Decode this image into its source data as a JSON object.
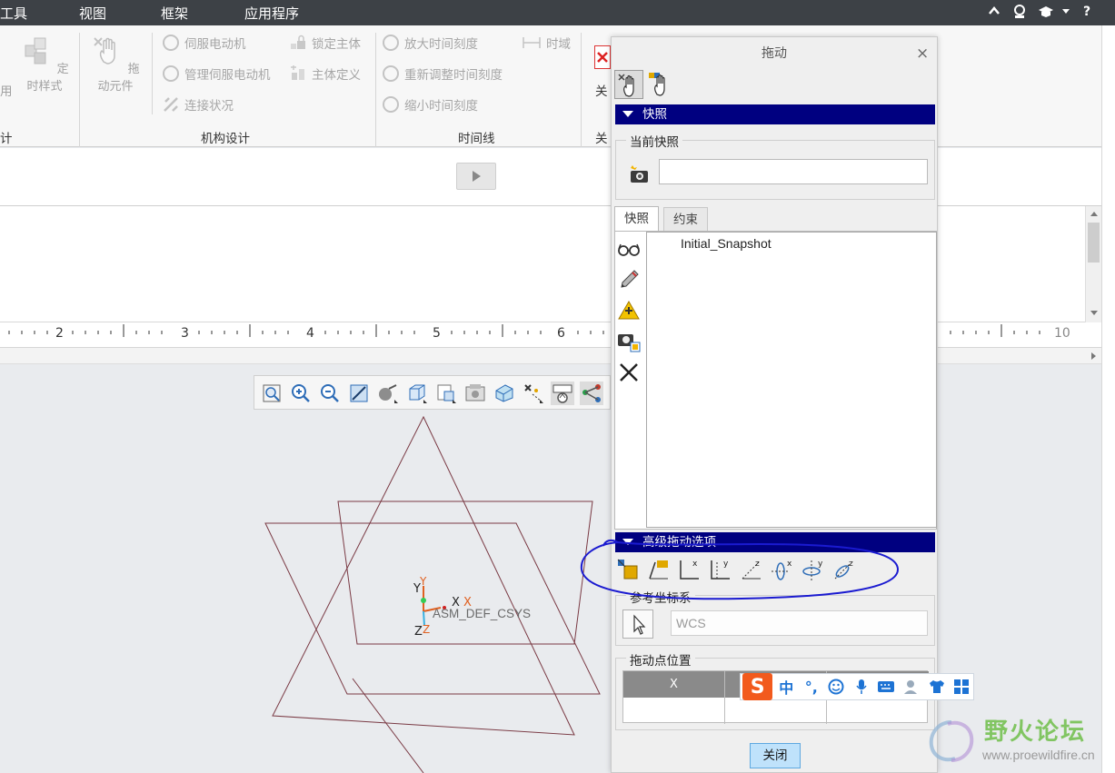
{
  "menubar": {
    "items": [
      "工具",
      "视图",
      "框架",
      "应用程序"
    ]
  },
  "ribbon": {
    "left_cut_label": "用",
    "left_group_cut": "计",
    "timing_style": "定时样式",
    "drag_components": "拖动元件",
    "servo_motor": "伺服电动机",
    "manage_servo_motors": "管理伺服电动机",
    "connection_status": "连接状况",
    "lock_body": "锁定主体",
    "body_definition": "主体定义",
    "zoom_in_timescale": "放大时间刻度",
    "readjust_timescale": "重新调整时间刻度",
    "zoom_out_timescale": "缩小时间刻度",
    "time_domain": "时域",
    "close_cut": "关",
    "groups": {
      "mechanism_design": "机构设计",
      "timeline": "时间线",
      "close_cut": "关"
    }
  },
  "ruler": {
    "labels": [
      "2",
      "3",
      "4",
      "5",
      "6",
      "10"
    ]
  },
  "graphics": {
    "csys_name": "ASM_DEF_CSYS",
    "axis_x": "X",
    "axis_y": "Y",
    "axis_z": "Z",
    "axis_x2": "X",
    "axis_y2": "Y",
    "axis_z2": "Z"
  },
  "dialog": {
    "title": "拖动",
    "close_x": "×",
    "snapshot_section": "快照",
    "current_snapshot_legend": "当前快照",
    "current_snapshot_value": "",
    "tabs": [
      "快照",
      "约束"
    ],
    "snapshots": [
      "Initial_Snapshot"
    ],
    "advanced_section": "高级拖动选项",
    "ref_csys_legend": "参考坐标系",
    "ref_csys_value": "WCS",
    "drag_point_legend": "拖动点位置",
    "drag_point_headers": [
      "X",
      "",
      ""
    ],
    "close_button": "关闭"
  },
  "ime": {
    "logo": "S",
    "mode": "中",
    "punct": "°,"
  },
  "watermark": {
    "name": "野火论坛",
    "url": "www.proewildfire.cn"
  },
  "colors": {
    "section_bar": "#000080",
    "menubar": "#3d4146",
    "annotation_ink": "#1a1ad0",
    "model_lines": "#7a3a44"
  }
}
